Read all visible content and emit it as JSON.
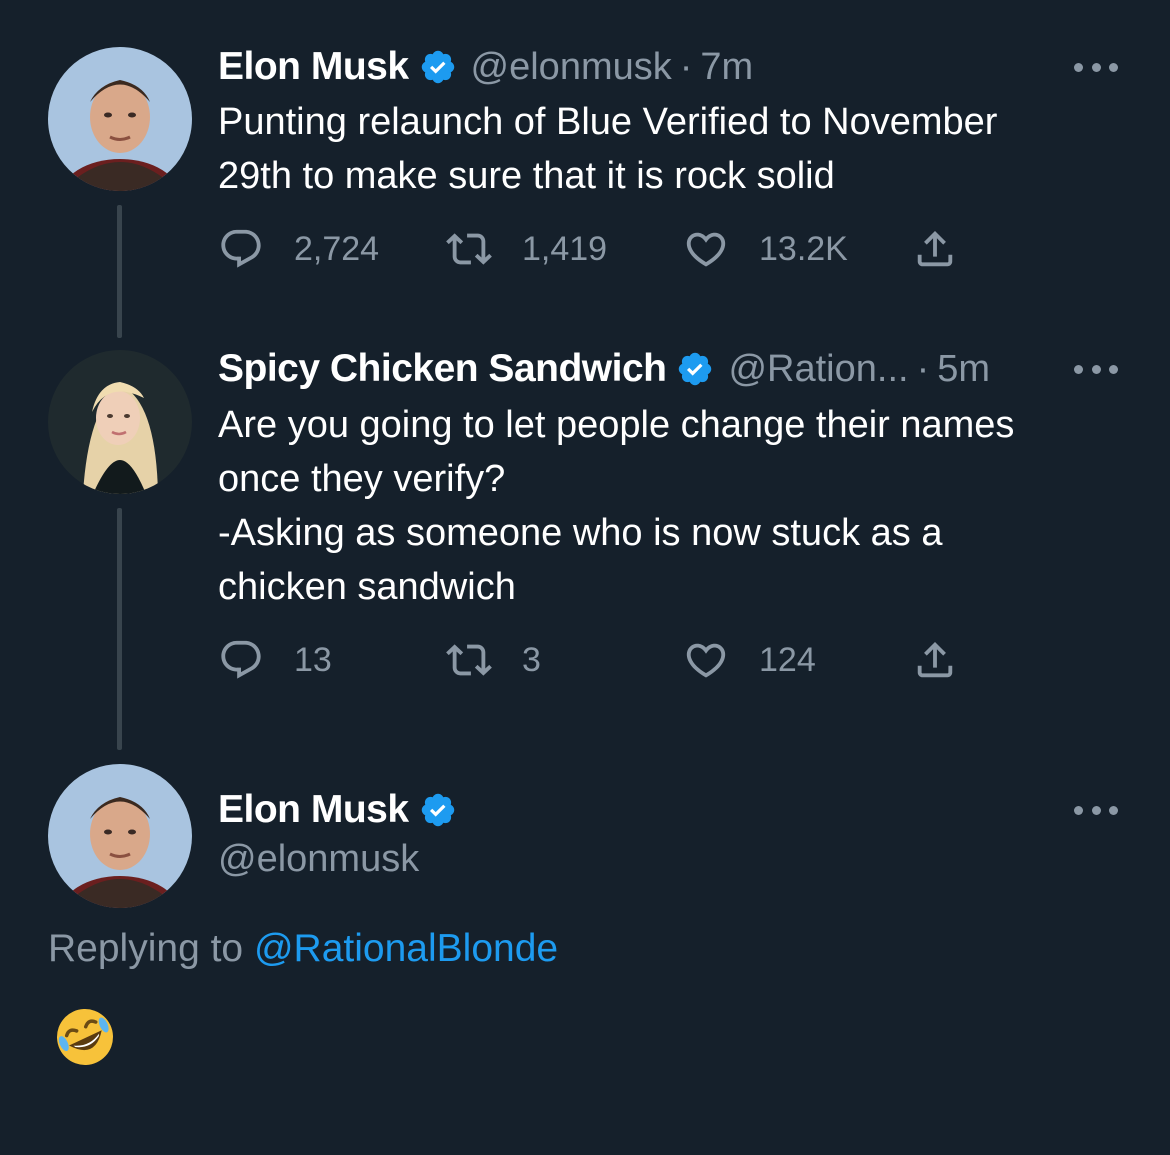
{
  "colors": {
    "background": "#15202b",
    "secondary_text": "#8b98a5",
    "verified_blue": "#1d9bf0",
    "thread_line": "#38444d"
  },
  "tweets": [
    {
      "display_name": "Elon Musk",
      "handle": "@elonmusk",
      "separator": "·",
      "time": "7m",
      "verified": true,
      "text": "Punting relaunch of Blue Verified to November\n29th to make sure that it is rock solid",
      "replies": "2,724",
      "retweets": "1,419",
      "likes": "13.2K"
    },
    {
      "display_name": "Spicy Chicken Sandwich",
      "handle": "@Ration...",
      "separator": "·",
      "time": "5m",
      "verified": true,
      "text": "Are you going to let people change their names\nonce they verify?\n-Asking as someone who is now stuck as a\nchicken sandwich",
      "replies": "13",
      "retweets": "3",
      "likes": "124"
    }
  ],
  "main_tweet": {
    "display_name": "Elon Musk",
    "handle": "@elonmusk",
    "verified": true,
    "replying_prefix": "Replying to",
    "replying_to": "@RationalBlonde",
    "reply_emoji": "rolling-on-the-floor-laughing"
  },
  "icons": {
    "verified": "verified-badge-icon",
    "more": "more-options-icon",
    "reply": "reply-icon",
    "retweet": "retweet-icon",
    "like": "like-heart-icon",
    "share": "share-icon"
  }
}
